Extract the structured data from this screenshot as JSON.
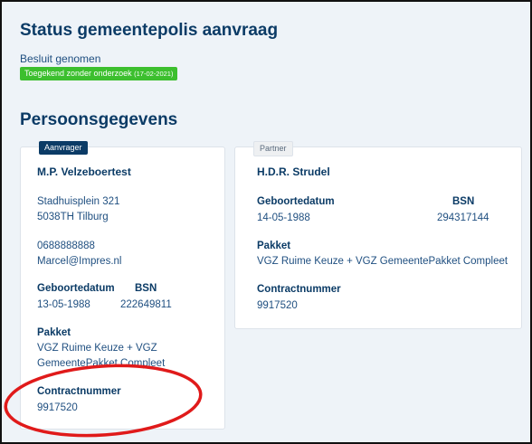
{
  "header": {
    "title": "Status gemeentepolis aanvraag",
    "status_text": "Besluit genomen",
    "badge_text": "Toegekend zonder onderzoek",
    "badge_date": "(17-02-2021)"
  },
  "section_title": "Persoonsgegevens",
  "applicant": {
    "tab_label": "Aanvrager",
    "name": "M.P. Velzeboertest",
    "address_line1": "Stadhuisplein 321",
    "address_line2": "5038TH Tilburg",
    "phone": "0688888888",
    "email": "Marcel@Impres.nl",
    "birthdate_label": "Geboortedatum",
    "birthdate": "13-05-1988",
    "bsn_label": "BSN",
    "bsn": "222649811",
    "package_label": "Pakket",
    "package_line1": "VGZ Ruime Keuze + VGZ",
    "package_line2": "GemeentePakket Compleet",
    "contract_label": "Contractnummer",
    "contract": "9917520"
  },
  "partner": {
    "tab_label": "Partner",
    "name": "H.D.R. Strudel",
    "birthdate_label": "Geboortedatum",
    "birthdate": "14-05-1988",
    "bsn_label": "BSN",
    "bsn": "294317144",
    "package_label": "Pakket",
    "package": "VGZ Ruime Keuze + VGZ GemeentePakket Compleet",
    "contract_label": "Contractnummer",
    "contract": "9917520"
  },
  "colors": {
    "primary": "#0b3b66",
    "badge_green": "#3cbf2e",
    "annotation_red": "#e01a1a",
    "background": "#eef3f8"
  }
}
